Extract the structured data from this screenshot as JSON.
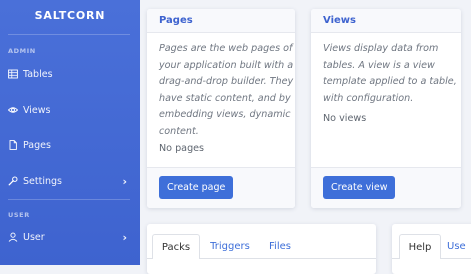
{
  "sidebar": {
    "brand": "SALTCORN",
    "sections": [
      {
        "label": "ADMIN"
      },
      {
        "label": "USER"
      }
    ],
    "items": [
      {
        "label": "Tables",
        "icon": "table-icon"
      },
      {
        "label": "Views",
        "icon": "eye-icon"
      },
      {
        "label": "Pages",
        "icon": "file-icon"
      },
      {
        "label": "Settings",
        "icon": "wrench-icon",
        "expandable": true
      },
      {
        "label": "User",
        "icon": "user-icon",
        "expandable": true
      }
    ]
  },
  "cards": {
    "pages": {
      "title": "Pages",
      "desc_lines": [
        "Pages are the web pages of",
        "your application built with a",
        "drag-and-drop builder. They",
        "have static content, and by",
        "embedding views, dynamic",
        "content."
      ],
      "empty": "No pages",
      "button": "Create page"
    },
    "views": {
      "title": "Views",
      "desc_lines": [
        "Views display data from",
        "tables. A view is a view",
        "template applied to a table,",
        "with configuration."
      ],
      "empty": "No views",
      "button": "Create view"
    }
  },
  "bottom_tabs": {
    "left": [
      "Packs",
      "Triggers",
      "Files"
    ],
    "right": [
      "Help",
      "Use"
    ]
  },
  "colors": {
    "accent": "#3e63cf",
    "sidebar": "#4a70d9",
    "button": "#3e6fd9"
  }
}
